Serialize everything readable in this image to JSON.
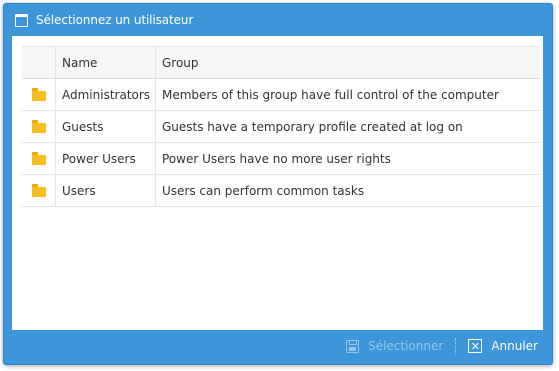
{
  "dialog": {
    "title": "Sélectionnez un utilisateur",
    "title_icon": "window-icon"
  },
  "grid": {
    "columns": [
      "",
      "Name",
      "Group"
    ],
    "rows": [
      {
        "icon": "folder-icon",
        "name": "Administrators",
        "group": "Members of this group have full control of the computer"
      },
      {
        "icon": "folder-icon",
        "name": "Guests",
        "group": "Guests have a temporary profile created at log on"
      },
      {
        "icon": "folder-icon",
        "name": "Power Users",
        "group": "Power Users have no more user rights"
      },
      {
        "icon": "folder-icon",
        "name": "Users",
        "group": "Users can perform common tasks"
      }
    ]
  },
  "footer": {
    "select_label": "Sélectionner",
    "select_icon": "save-icon",
    "select_enabled": false,
    "cancel_label": "Annuler",
    "cancel_icon": "close-icon"
  },
  "colors": {
    "accent": "#3d95da",
    "folder": "#f5bf1e"
  }
}
